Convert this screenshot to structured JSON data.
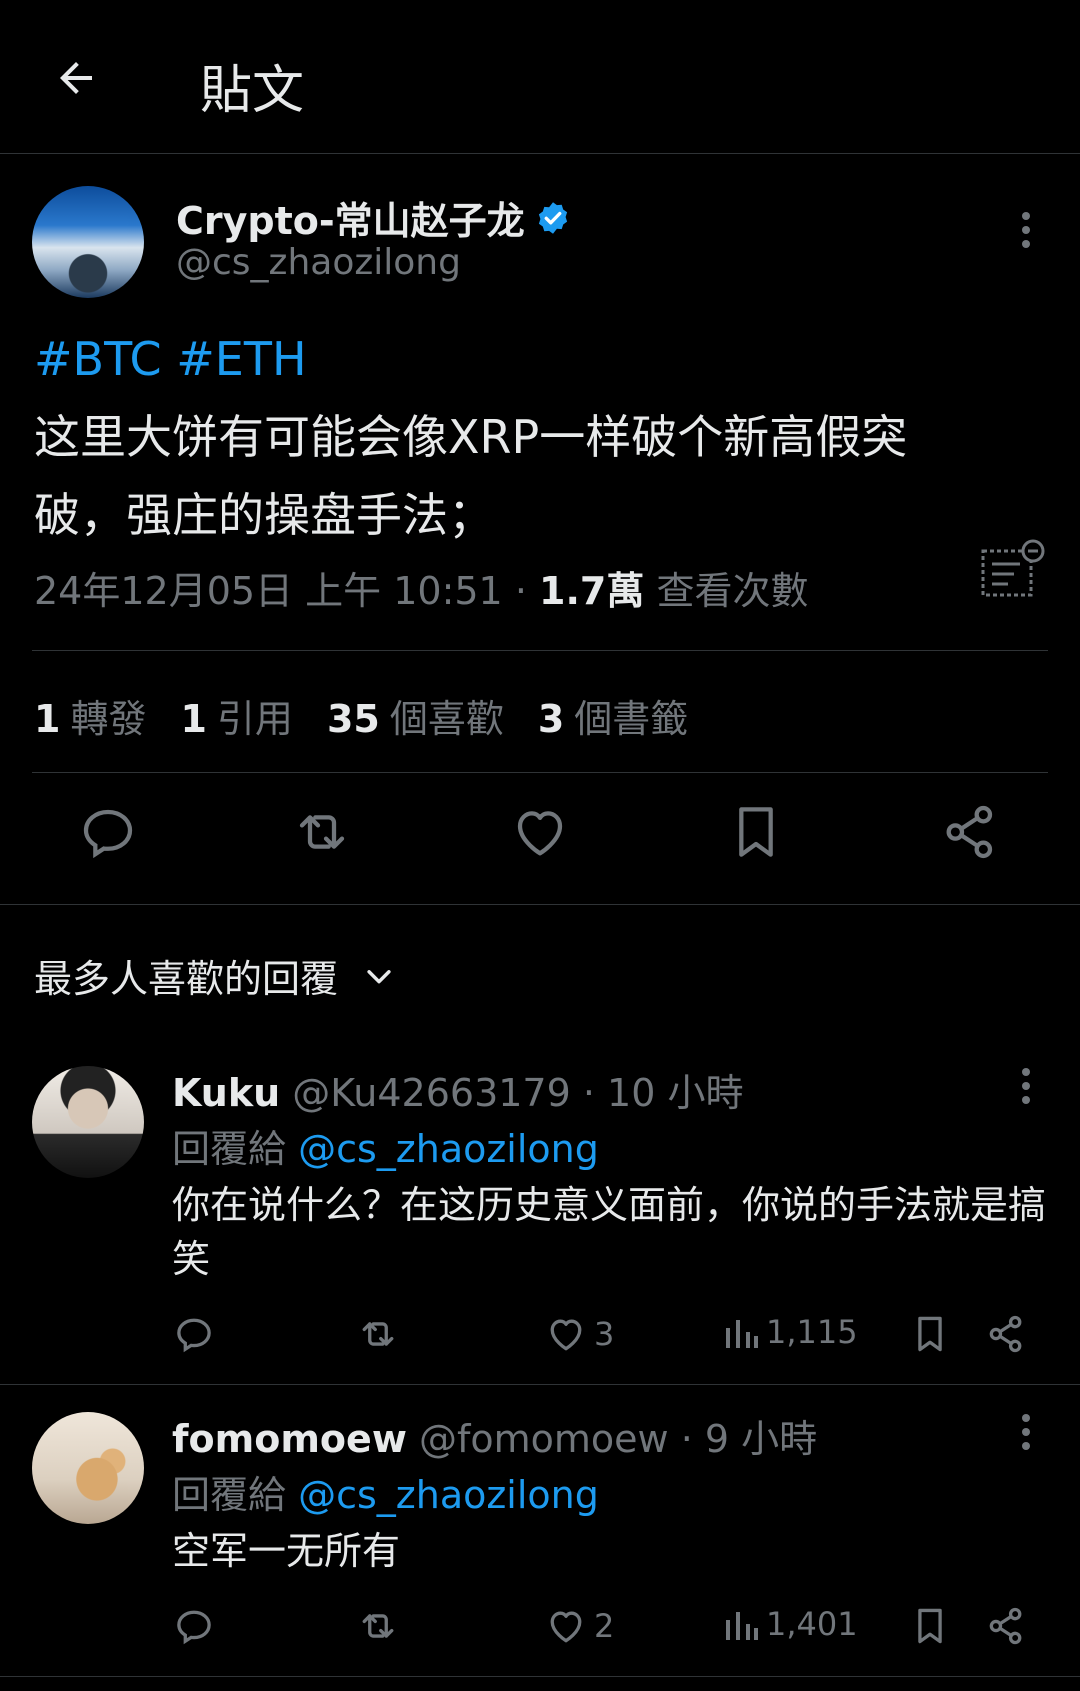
{
  "header": {
    "title": "貼文"
  },
  "tweet": {
    "author_name": "Crypto-常山赵子龙",
    "author_handle": "@cs_zhaozilong",
    "hashtag1": "#BTC",
    "hashtag2": "#ETH",
    "text_line1": "这里大饼有可能会像XRP一样破个新高假突",
    "text_line2": "破，强庄的操盘手法；",
    "timestamp": "24年12月05日 上午 10:51",
    "separator": "·",
    "views_count": "1.7萬",
    "views_label": "查看次數"
  },
  "stats": {
    "reposts_count": "1",
    "reposts_label": "轉發",
    "quotes_count": "1",
    "quotes_label": "引用",
    "likes_count": "35",
    "likes_label": "個喜歡",
    "bookmarks_count": "3",
    "bookmarks_label": "個書籤"
  },
  "replies_sort": {
    "label": "最多人喜歡的回覆"
  },
  "replies": [
    {
      "name": "Kuku",
      "handle": "@Ku42663179",
      "time": "· 10 小時",
      "reply_to_label": "回覆給",
      "reply_to_handle": "@cs_zhaozilong",
      "text": "你在说什么？在这历史意义面前，你说的手法就是搞笑",
      "likes": "3",
      "views": "1,115"
    },
    {
      "name": "fomomoew",
      "handle": "@fomomoew",
      "time": "· 9 小時",
      "reply_to_label": "回覆給",
      "reply_to_handle": "@cs_zhaozilong",
      "text": "空军一无所有",
      "likes": "2",
      "views": "1,401"
    }
  ],
  "colors": {
    "background": "#000000",
    "text_primary": "#e7e9ea",
    "text_secondary": "#71767b",
    "accent_blue": "#1d9bf0",
    "divider": "#2f3336"
  },
  "icons": [
    "back-arrow-icon",
    "verified-badge-icon",
    "more-icon",
    "analytics-icon",
    "reply-icon",
    "repost-icon",
    "like-icon",
    "bookmark-icon",
    "share-icon",
    "chevron-down-icon",
    "views-icon"
  ]
}
